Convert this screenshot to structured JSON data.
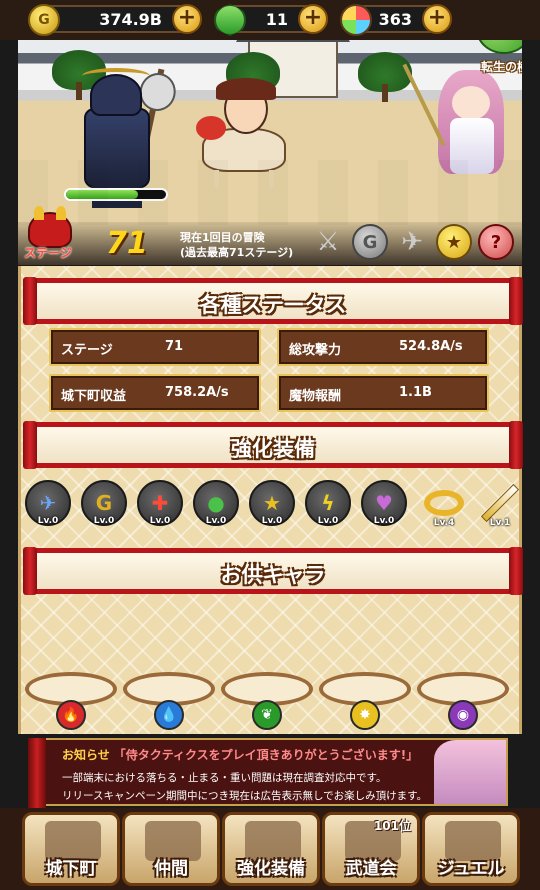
{
  "resources": {
    "gold": {
      "icon": "gold-coin-icon",
      "symbol": "G",
      "value": "374.9B"
    },
    "gem": {
      "icon": "green-gem-icon",
      "value": "11"
    },
    "orbs": {
      "icon": "multicolor-orb-icon",
      "value": "363"
    },
    "plus_symbol": "+"
  },
  "rebirth_tree": {
    "label": "転生の樹"
  },
  "battle": {
    "enemy_hp_fraction": 0.72
  },
  "stage": {
    "label": "ステージ",
    "number": "71",
    "adventure_line1": "現在1回目の冒険",
    "adventure_line2": "(過去最高71ステージ)",
    "icons": [
      "sword-icon",
      "gray-coin-icon",
      "winged-boot-icon",
      "star-icon",
      "help-icon"
    ],
    "coin_symbol": "G",
    "star_symbol": "★",
    "help_symbol": "?"
  },
  "status": {
    "title": "各種ステータス",
    "stats": [
      {
        "key": "ステージ",
        "value": "71"
      },
      {
        "key": "総攻撃力",
        "value": "524.8A/s"
      },
      {
        "key": "城下町収益",
        "value": "758.2A/s"
      },
      {
        "key": "魔物報酬",
        "value": "1.1B"
      }
    ]
  },
  "equipment": {
    "title": "強化装備",
    "items": [
      {
        "icon": "winged-boot-icon",
        "glyph": "✈",
        "color": "#6aa4ff",
        "level": "Lv.0"
      },
      {
        "icon": "gold-coin-icon",
        "glyph": "G",
        "color": "#e0b020",
        "level": "Lv.0"
      },
      {
        "icon": "red-cross-icon",
        "glyph": "✚",
        "color": "#ff4a3a",
        "level": "Lv.0"
      },
      {
        "icon": "green-orb-icon",
        "glyph": "●",
        "color": "#4ac24a",
        "level": "Lv.0"
      },
      {
        "icon": "star-icon",
        "glyph": "★",
        "color": "#e8c020",
        "level": "Lv.0"
      },
      {
        "icon": "lightning-icon",
        "glyph": "ϟ",
        "color": "#f0d020",
        "level": "Lv.0"
      },
      {
        "icon": "heart-icon",
        "glyph": "♥",
        "color": "#c86ad8",
        "level": "Lv.0"
      },
      {
        "icon": "gold-ring-icon",
        "glyph": "",
        "color": "#e8b42a",
        "level": "Lv.4"
      },
      {
        "icon": "golden-sword-icon",
        "glyph": "",
        "color": "#e0b030",
        "level": "Lv.1"
      }
    ]
  },
  "companions": {
    "title": "お供キャラ",
    "slots": [
      {
        "element_icon": "fire-element-icon",
        "glyph": "🔥",
        "color": "#d82a2a"
      },
      {
        "element_icon": "water-element-icon",
        "glyph": "💧",
        "color": "#2a7ad8"
      },
      {
        "element_icon": "leaf-element-icon",
        "glyph": "❦",
        "color": "#2a9a2a"
      },
      {
        "element_icon": "light-element-icon",
        "glyph": "✸",
        "color": "#e8c020"
      },
      {
        "element_icon": "dark-element-icon",
        "glyph": "◉",
        "color": "#8a3ab8"
      }
    ]
  },
  "news": {
    "heading": "お知らせ",
    "headline": "「侍タクティクスをプレイ頂きありがとうございます!」",
    "line1": "一部端末における落ちる・止まる・重い問題は現在調査対応中です。",
    "line2": "リリースキャンペーン期間中につき現在は広告表示無しでお楽しみ頂けます。"
  },
  "nav": [
    {
      "label": "城下町",
      "icon": "castle-icon"
    },
    {
      "label": "仲間",
      "icon": "scroll-icon"
    },
    {
      "label": "強化装備",
      "icon": "crossed-swords-icon"
    },
    {
      "label": "武道会",
      "icon": "torii-gate-icon",
      "rank": "101位"
    },
    {
      "label": "ジュエル",
      "icon": "jewel-icon"
    }
  ]
}
